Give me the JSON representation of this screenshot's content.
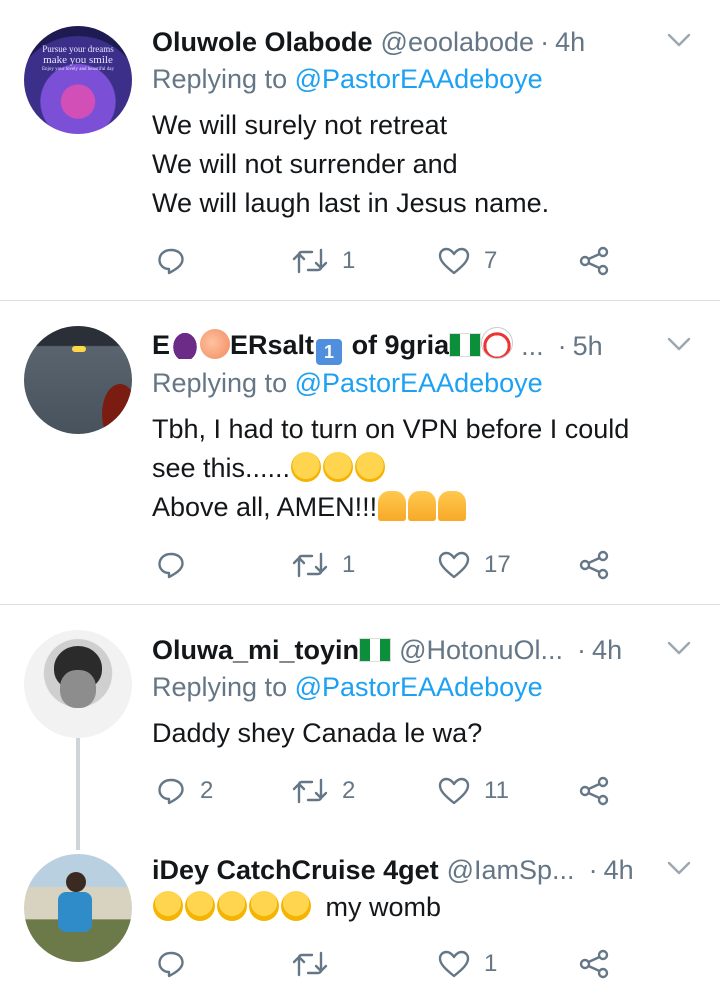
{
  "tweets": [
    {
      "name": "Oluwole Olabode",
      "handle": "@eoolabode",
      "time": "4h",
      "replying_prefix": "Replying to ",
      "replying_to": "@PastorEAAdeboye",
      "lines": [
        "We will surely not retreat",
        "We will not surrender and",
        "We will laugh last in Jesus name."
      ],
      "avatar_text_1": "Pursue your dreams",
      "avatar_text_2": "make you smile",
      "avatar_text_3": "Enjoy your lovely and beautiful day",
      "replies": "",
      "retweets": "1",
      "likes": "7"
    },
    {
      "name_prefix": "E",
      "name_mid": "ERsalt",
      "keycap": "1",
      "name_suffix": " of 9gria",
      "ellipsis": "...",
      "handle": "",
      "time": "5h",
      "replying_prefix": "Replying to ",
      "replying_to": "@PastorEAAdeboye",
      "line1": "Tbh, I had to turn on VPN before I could",
      "line2": "see this......",
      "line3": "Above all, AMEN!!!",
      "replies": "",
      "retweets": "1",
      "likes": "17"
    },
    {
      "name": "Oluwa_mi_toyin",
      "handle": "@HotonuOl...",
      "time": "4h",
      "replying_prefix": "Replying to ",
      "replying_to": "@PastorEAAdeboye",
      "line1": "Daddy shey Canada le wa?",
      "replies": "2",
      "retweets": "2",
      "likes": "11"
    },
    {
      "name": "iDey CatchCruise 4get",
      "handle": "@IamSp...",
      "time": "4h",
      "text": "my womb",
      "replies": "",
      "retweets": "",
      "likes": "1"
    }
  ],
  "separator": "·",
  "icons": {
    "menu": "chevron-down-icon",
    "reply": "reply-icon",
    "retweet": "retweet-icon",
    "like": "heart-icon",
    "share": "share-icon"
  },
  "colors": {
    "accent": "#1da1f2",
    "secondary_text": "#657786",
    "icon": "#657786"
  }
}
